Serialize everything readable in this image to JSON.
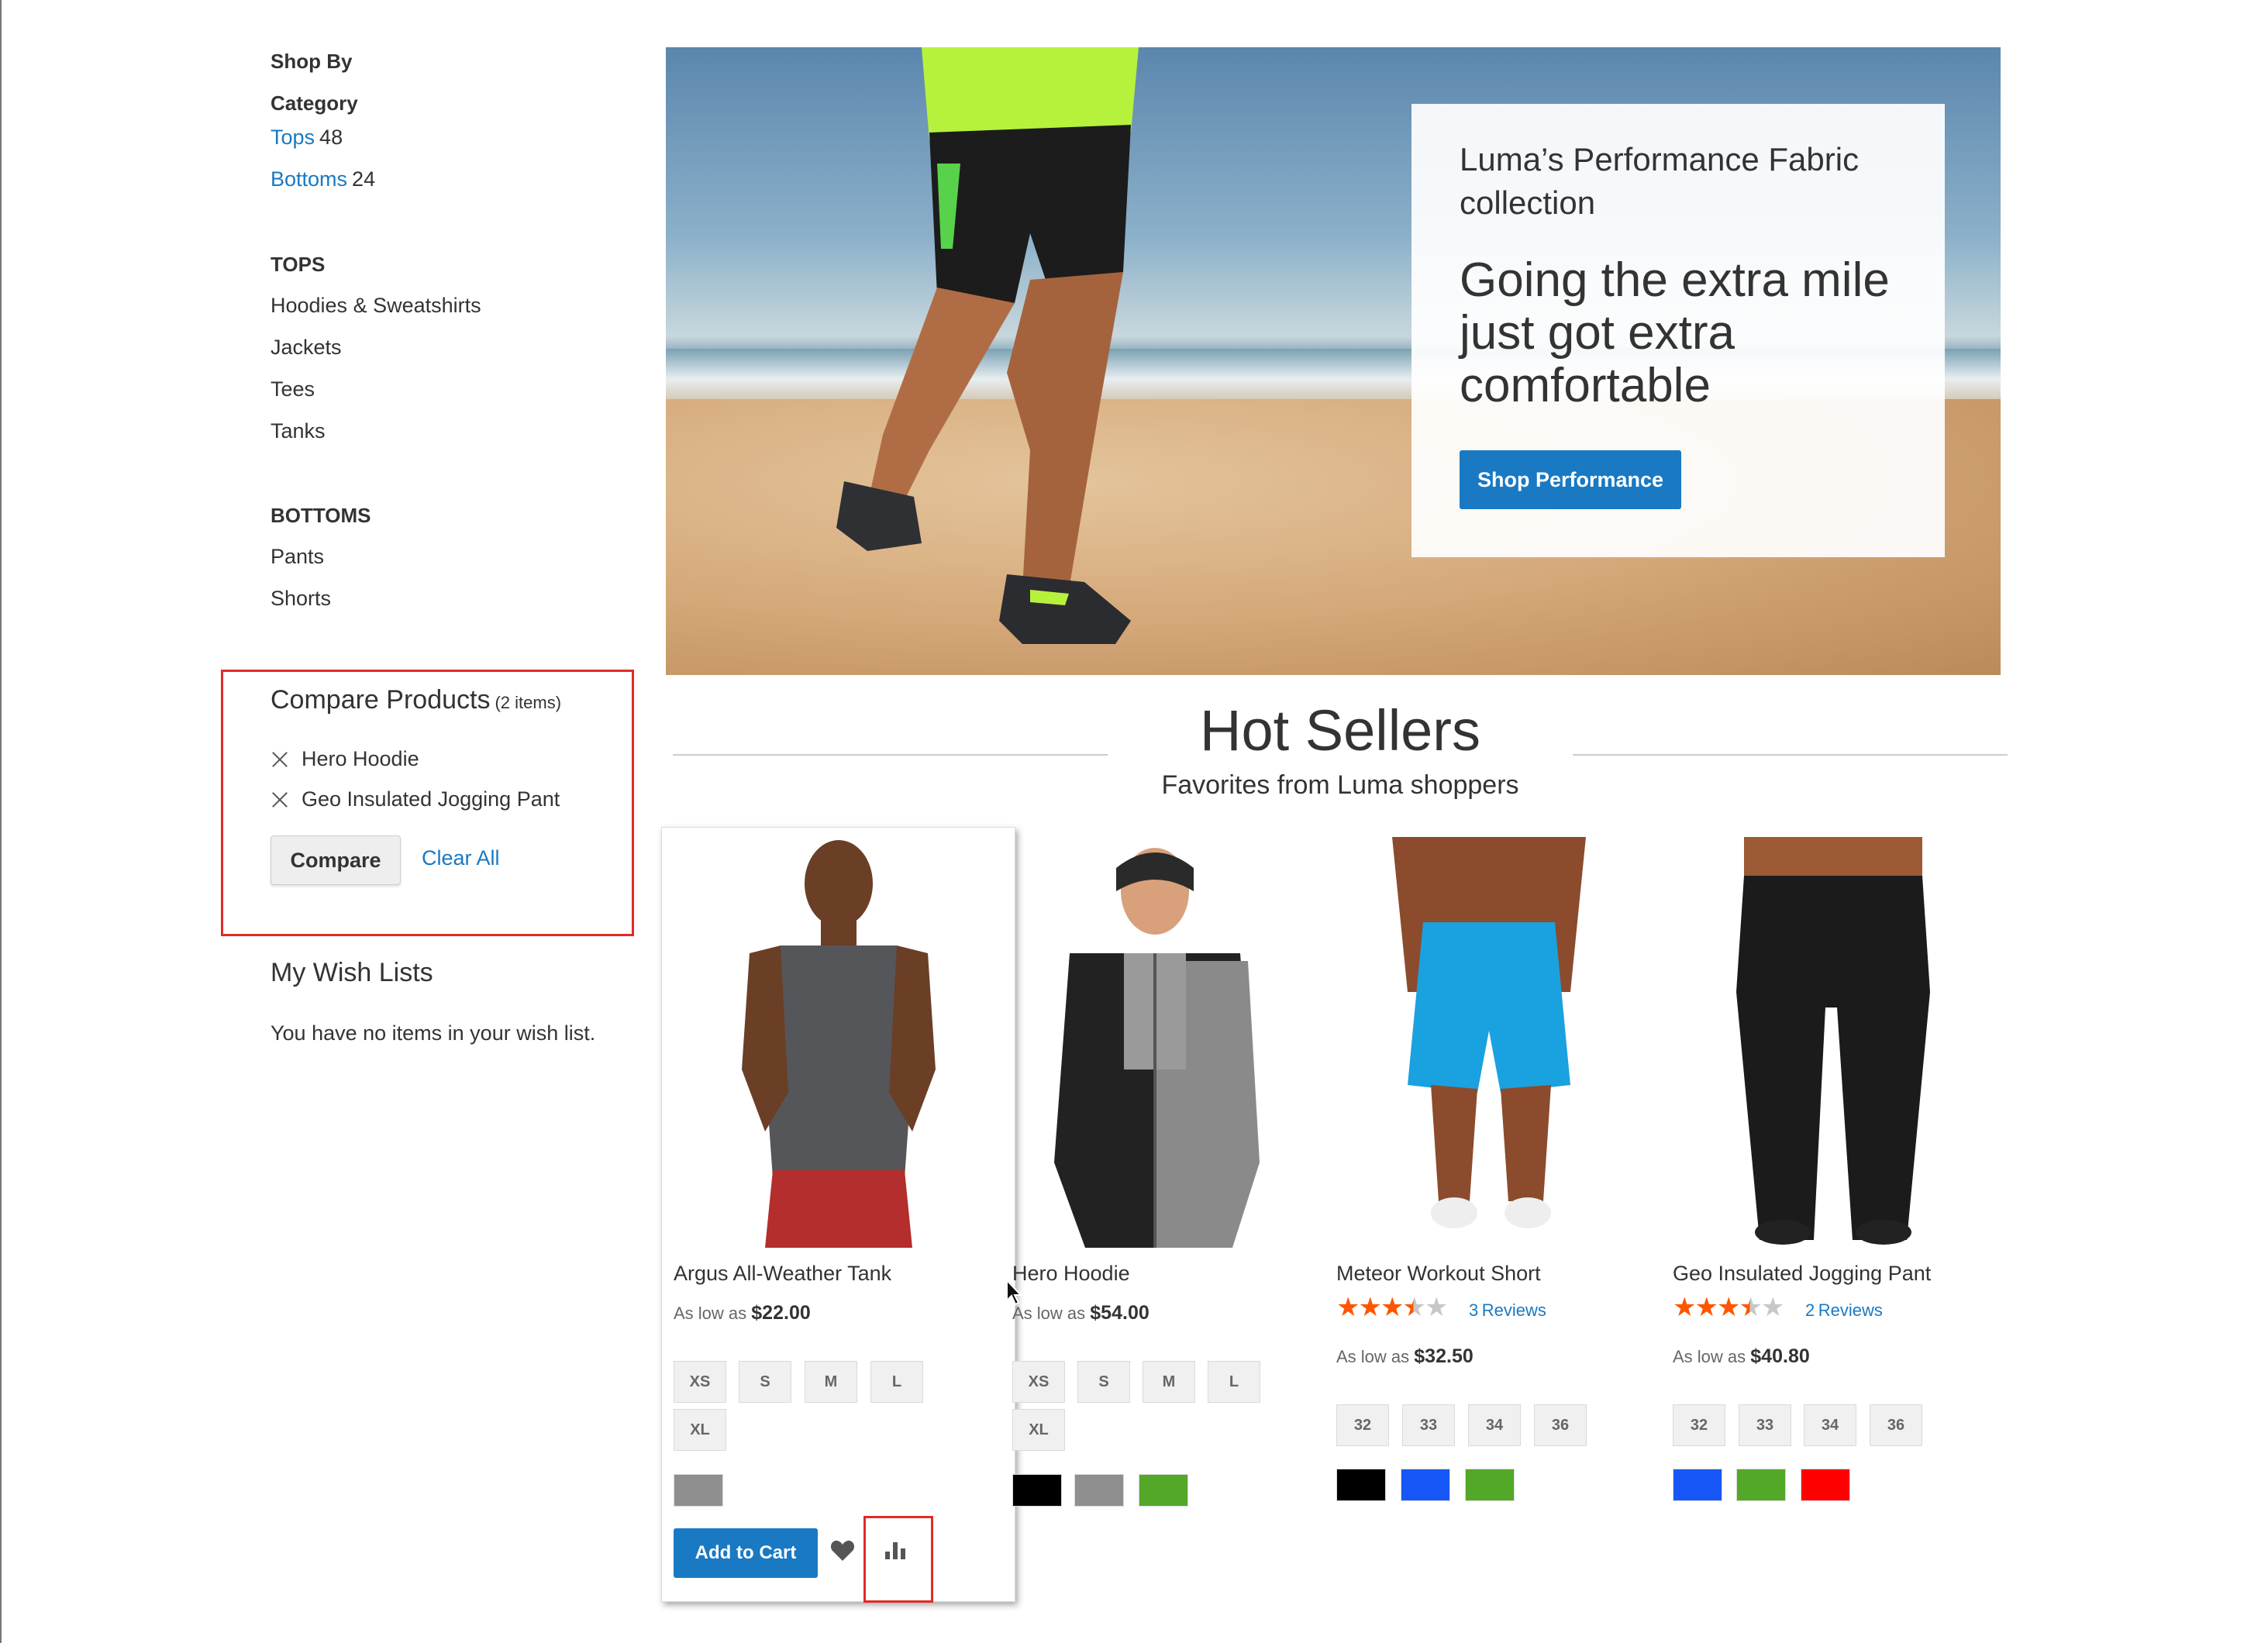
{
  "sidebar": {
    "shop_by": "Shop By",
    "category_title": "Category",
    "categories": [
      {
        "label": "Tops",
        "count": "48"
      },
      {
        "label": "Bottoms",
        "count": "24"
      }
    ],
    "tops_title": "TOPS",
    "tops_items": [
      "Hoodies & Sweatshirts",
      "Jackets",
      "Tees",
      "Tanks"
    ],
    "bottoms_title": "BOTTOMS",
    "bottoms_items": [
      "Pants",
      "Shorts"
    ],
    "compare": {
      "title": "Compare Products",
      "count": "(2 items)",
      "items": [
        "Hero Hoodie",
        "Geo Insulated Jogging Pant"
      ],
      "compare_button": "Compare",
      "clear_all": "Clear All"
    },
    "wishlist": {
      "title": "My Wish Lists",
      "empty_text": "You have no items in your wish list."
    }
  },
  "hero": {
    "subtitle": "Luma’s Performance Fabric collection",
    "headline": "Going the extra mile just got extra comfortable",
    "button": "Shop Performance"
  },
  "hot_sellers": {
    "title": "Hot Sellers",
    "subtitle": "Favorites from Luma shoppers",
    "products": [
      {
        "name": "Argus All-Weather Tank",
        "price_prefix": "As low as",
        "price": "$22.00",
        "sizes": [
          "XS",
          "S",
          "M",
          "L",
          "XL"
        ],
        "colors": [
          "#8f8f8f"
        ],
        "add_to_cart": "Add to Cart",
        "wishlist_icon": "heart-icon",
        "compare_icon": "bar-chart-icon"
      },
      {
        "name": "Hero Hoodie",
        "price_prefix": "As low as",
        "price": "$54.00",
        "sizes": [
          "XS",
          "S",
          "M",
          "L",
          "XL"
        ],
        "colors": [
          "#000000",
          "#8f8f8f",
          "#53a828"
        ]
      },
      {
        "name": "Meteor Workout Short",
        "rating": 3.5,
        "reviews_count": "3",
        "reviews_label": "Reviews",
        "price_prefix": "As low as",
        "price": "$32.50",
        "sizes": [
          "32",
          "33",
          "34",
          "36"
        ],
        "colors": [
          "#000000",
          "#1857f7",
          "#53a828"
        ]
      },
      {
        "name": "Geo Insulated Jogging Pant",
        "rating": 3.5,
        "reviews_count": "2",
        "reviews_label": "Reviews",
        "price_prefix": "As low as",
        "price": "$40.80",
        "sizes": [
          "32",
          "33",
          "34",
          "36"
        ],
        "colors": [
          "#1857f7",
          "#53a828",
          "#ff0000"
        ]
      }
    ]
  },
  "colors": {
    "accent_blue": "#1979c3",
    "highlight_red": "#e02b27",
    "star_orange": "#ff5501"
  }
}
